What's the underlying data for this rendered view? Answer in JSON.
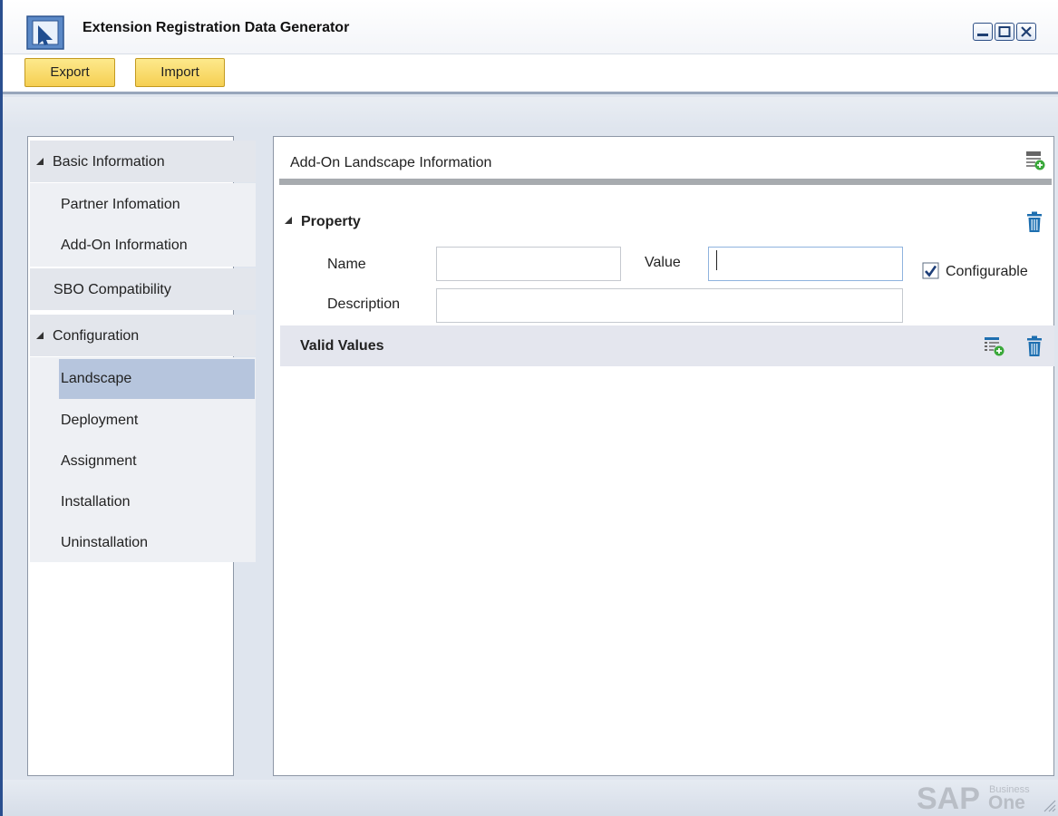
{
  "window": {
    "title": "Extension Registration Data Generator"
  },
  "toolbar": {
    "export_label": "Export",
    "import_label": "Import"
  },
  "nav": {
    "groups": [
      {
        "label": "Basic Information",
        "items": [
          "Partner Infomation",
          "Add-On Information"
        ]
      },
      {
        "label": "SBO Compatibility",
        "items": []
      },
      {
        "label": "Configuration",
        "items": [
          "Landscape",
          "Deployment",
          "Assignment",
          "Installation",
          "Uninstallation"
        ]
      }
    ],
    "selected_item": "Landscape"
  },
  "content": {
    "section_title": "Add-On Landscape Information",
    "property": {
      "header": "Property",
      "name_label": "Name",
      "name_value": "",
      "value_label": "Value",
      "value_value": "",
      "description_label": "Description",
      "description_value": "",
      "configurable_label": "Configurable",
      "configurable_checked": true
    },
    "valid_values": {
      "header": "Valid Values"
    }
  },
  "branding": {
    "logo_sap": "SAP",
    "logo_business": "Business",
    "logo_one": "One"
  },
  "icons": {
    "app": "app-logo-icon",
    "minimize": "minimize-icon",
    "maximize": "maximize-icon",
    "close": "close-icon",
    "add_section": "add-section-icon",
    "add_row": "add-row-icon",
    "delete": "trash-icon",
    "grip": "resize-grip-icon"
  },
  "colors": {
    "window_border": "#2a4f8f",
    "button_fill": "#f5cf52",
    "nav_selected": "#b6c5dd",
    "trash_blue": "#1e6fb0",
    "add_green": "#3aa83a",
    "sap_blue": "#003f88",
    "sap_gold": "#f0ab00"
  }
}
